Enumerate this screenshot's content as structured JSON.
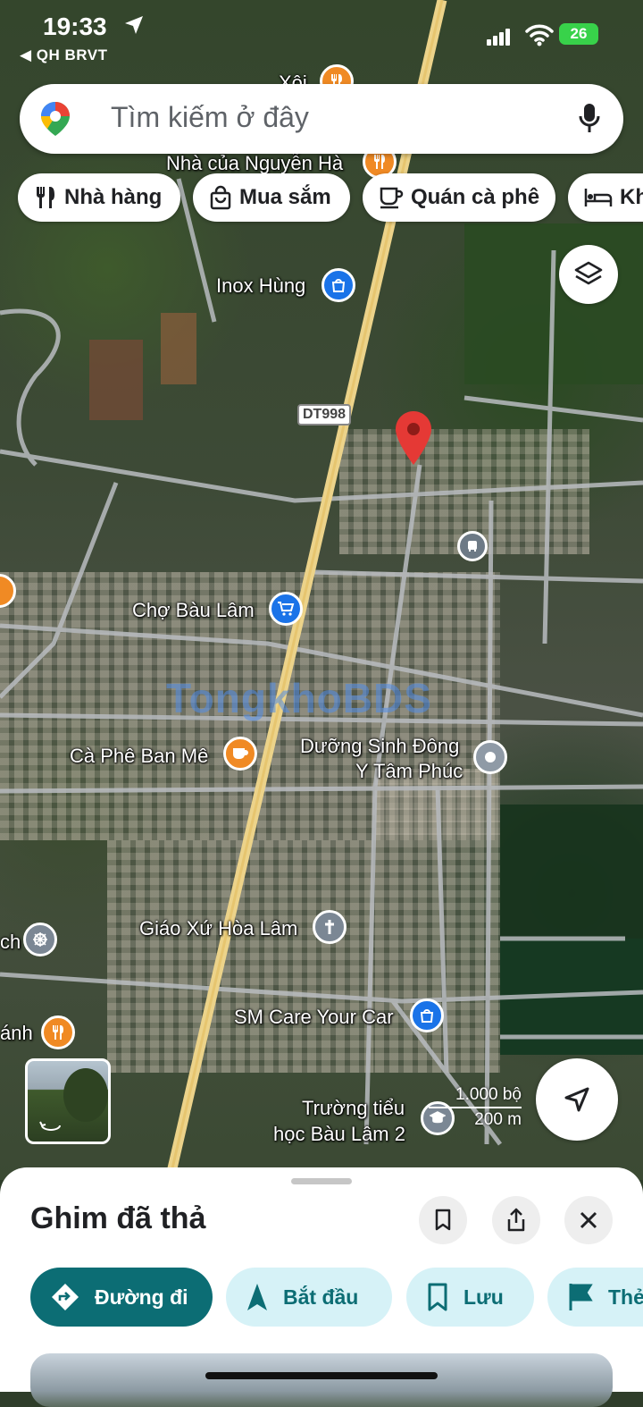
{
  "status_bar": {
    "time": "19:33",
    "back_app": "◀ QH BRVT",
    "battery": "26"
  },
  "search": {
    "placeholder": "Tìm kiếm ở đây"
  },
  "chips": [
    {
      "label": "Nhà hàng",
      "icon": "fork-knife-icon"
    },
    {
      "label": "Mua sắm",
      "icon": "shopping-bag-icon"
    },
    {
      "label": "Quán cà phê",
      "icon": "coffee-cup-icon"
    },
    {
      "label": "Kh",
      "icon": "bed-icon"
    }
  ],
  "map": {
    "labels": {
      "xoi": "Xôi",
      "nguyen_ha": "Nhà của Nguyễn Hà",
      "inox_hung": "Inox Hùng",
      "route": "DT998",
      "cho_bau_lam": "Chợ Bàu Lâm",
      "ca_phe": "Cà Phê Ban Mê",
      "duong_sinh_1": "Dưỡng Sinh Đông",
      "duong_sinh_2": "Y Tâm Phúc",
      "giao_xu": "Giáo Xứ Hòa Lâm",
      "left_ch": "ch",
      "left_anh": "ánh",
      "sm_care": "SM Care Your Car",
      "truong_1": "Trường tiểu",
      "truong_2": "học Bàu Lâm 2"
    },
    "watermark": "TongkhoBDS",
    "scale_feet": "1.000 bộ",
    "scale_m": "200 m",
    "pin_color": "#e53935"
  },
  "sheet": {
    "title": "Ghim đã thả",
    "actions": [
      {
        "label": "Đường đi",
        "icon": "directions-icon"
      },
      {
        "label": "Bắt đầu",
        "icon": "navigation-arrow-icon"
      },
      {
        "label": "Lưu",
        "icon": "bookmark-icon"
      },
      {
        "label": "Thẻ",
        "icon": "flag-icon"
      }
    ]
  }
}
